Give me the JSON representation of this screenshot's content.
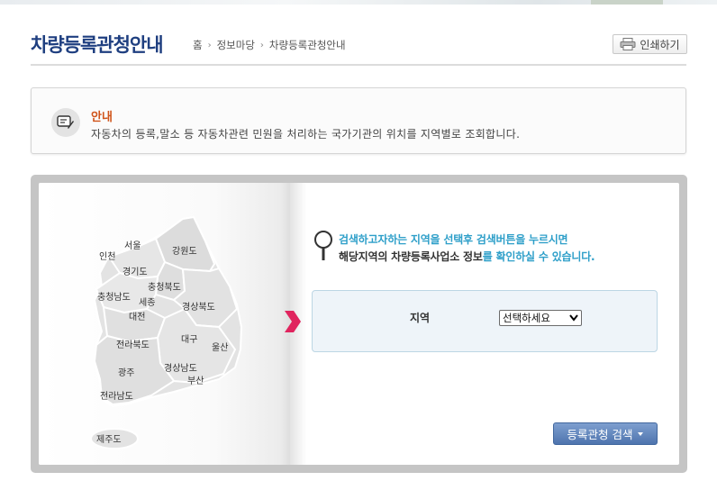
{
  "page": {
    "title": "차량등록관청안내",
    "print_label": "인쇄하기"
  },
  "breadcrumb": [
    "홈",
    "정보마당",
    "차량등록관청안내"
  ],
  "notice": {
    "title": "안내",
    "text": "자동차의 등록,말소 등 자동차관련 민원을 처리하는 국가기관의 위치를 지역별로 조회합니다."
  },
  "map": {
    "regions": [
      "서울",
      "인천",
      "강원도",
      "경기도",
      "충청북도",
      "충청남도",
      "세종",
      "대전",
      "경상북도",
      "대구",
      "울산",
      "전라북도",
      "경상남도",
      "광주",
      "부산",
      "전라남도",
      "제주도"
    ]
  },
  "guide": {
    "line1": "검색하고자하는 지역을 선택후 검색버튼을 누르시면",
    "line2_pre": "해당지역의 차량등록사업소 정보",
    "line2_hl": "를 확인하실 수 있습니다."
  },
  "search": {
    "field_label": "지역",
    "select_value": "선택하세요",
    "button_label": "등록관청 검색"
  },
  "colors": {
    "title": "#1f3f80",
    "notice_title": "#d0541a",
    "guide_accent": "#2e9fc9",
    "arrow": "#e0245e",
    "button": "#4e74ae"
  }
}
